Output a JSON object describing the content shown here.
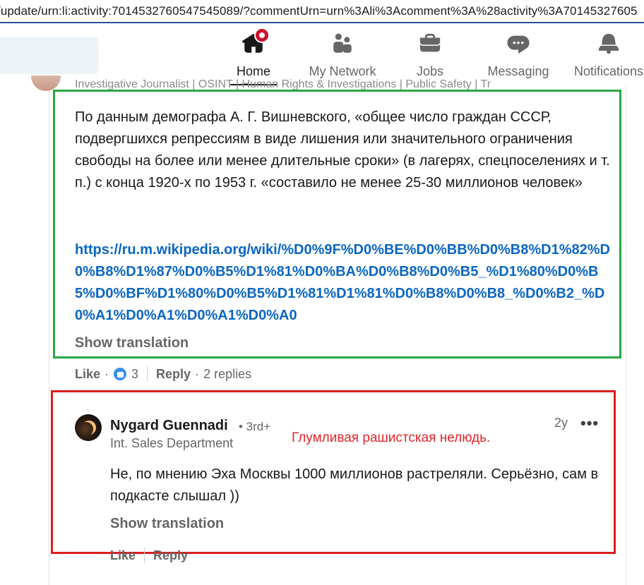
{
  "browser": {
    "url": "/update/urn:li:activity:7014532760547545089/?commentUrn=urn%3Ali%3Acomment%3A%28activity%3A70145327605"
  },
  "nav": {
    "home": "Home",
    "network": "My Network",
    "jobs": "Jobs",
    "messaging": "Messaging",
    "notifications": "Notifications"
  },
  "cutoff_headline": "Investigative Journalist | OSINT | Human Rights & Investigations | Public Safety | Tr",
  "comment": {
    "text": "По данным демографа А. Г. Вишневского, «общее число граждан СССР, подвергшихся репрессиям в виде лишения или значительного ограничения свободы на более или менее длительные сроки» (в лагерях, спецпоселениях и т. п.) с конца 1920-х по 1953 г. «составило не менее 25-30 миллионов человек»",
    "link": "https://ru.m.wikipedia.org/wiki/%D0%9F%D0%BE%D0%BB%D0%B8%D1%82%D0%B8%D1%87%D0%B5%D1%81%D0%BA%D0%B8%D0%B5_%D1%80%D0%B5%D0%BF%D1%80%D0%B5%D1%81%D1%81%D0%B8%D0%B8_%D0%B2_%D0%A1%D0%A1%D0%A1%D0%A0",
    "show_translation": "Show translation",
    "like_label": "Like",
    "reaction_count": "3",
    "reply_label": "Reply",
    "replies_text": "2 replies"
  },
  "reply": {
    "author": "Nygard Guennadi",
    "degree": "• 3rd+",
    "headline": "Int. Sales Department",
    "time": "2y",
    "more": "•••",
    "text": "Не, по мнению Эха Москвы 1000 миллионов растреляли. Серьёзно, сам в подкасте слышал ))",
    "show_translation": "Show translation",
    "like_label": "Like",
    "reply_label": "Reply"
  },
  "annotation": "Глумливая рашистская нелюдь.",
  "colors": {
    "green_box": "#27a844",
    "red_box": "#dd1c1c",
    "annotation": "#e0262b",
    "link": "#0a66c2",
    "notification_badge": "#cb112d"
  }
}
